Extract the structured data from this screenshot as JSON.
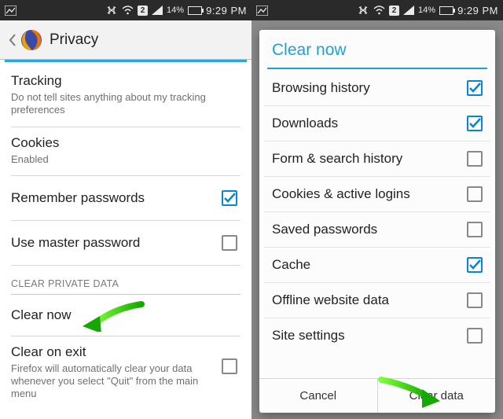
{
  "status": {
    "sim_badge": "2",
    "battery_pct": "14%",
    "time": "9:29 PM"
  },
  "left": {
    "title": "Privacy",
    "tracking_title": "Tracking",
    "tracking_sub": "Do not tell sites anything about my tracking preferences",
    "cookies_title": "Cookies",
    "cookies_sub": "Enabled",
    "remember_pw": "Remember passwords",
    "master_pw": "Use master password",
    "section_header": "CLEAR PRIVATE DATA",
    "clear_now": "Clear now",
    "clear_exit_title": "Clear on exit",
    "clear_exit_sub": "Firefox will automatically clear your data whenever you select \"Quit\" from the main menu"
  },
  "dialog": {
    "title": "Clear now",
    "items": [
      {
        "label": "Browsing history",
        "checked": true
      },
      {
        "label": "Downloads",
        "checked": true
      },
      {
        "label": "Form & search history",
        "checked": false
      },
      {
        "label": "Cookies & active logins",
        "checked": false
      },
      {
        "label": "Saved passwords",
        "checked": false
      },
      {
        "label": "Cache",
        "checked": true
      },
      {
        "label": "Offline website data",
        "checked": false
      },
      {
        "label": "Site settings",
        "checked": false
      }
    ],
    "cancel": "Cancel",
    "confirm": "Clear data"
  },
  "checkmark_color": "#0a84d6",
  "arrow_color": "#1fb90e"
}
